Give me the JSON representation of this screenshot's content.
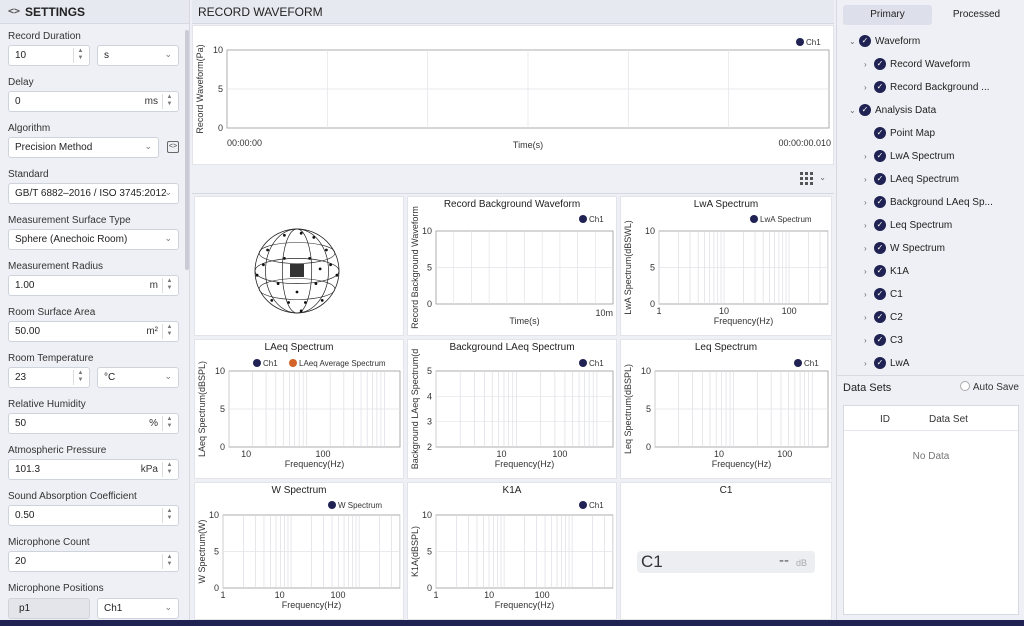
{
  "settings": {
    "title": "SETTINGS",
    "code_icon": "<>",
    "record_duration": {
      "label": "Record Duration",
      "value": "10",
      "unit": "s"
    },
    "delay": {
      "label": "Delay",
      "value": "0",
      "unit": "ms"
    },
    "algorithm": {
      "label": "Algorithm",
      "value": "Precision Method"
    },
    "standard": {
      "label": "Standard",
      "value": "GB/T 6882–2016 / ISO 3745:2012"
    },
    "surface_type": {
      "label": "Measurement Surface Type",
      "value": "Sphere (Anechoic Room)"
    },
    "radius": {
      "label": "Measurement Radius",
      "value": "1.00",
      "unit": "m"
    },
    "room_area": {
      "label": "Room Surface Area",
      "value": "50.00",
      "unit": "m²"
    },
    "room_temp": {
      "label": "Room Temperature",
      "value": "23",
      "unit": "°C"
    },
    "humidity": {
      "label": "Relative Humidity",
      "value": "50",
      "unit": "%"
    },
    "pressure": {
      "label": "Atmospheric Pressure",
      "value": "101.3",
      "unit": "kPa"
    },
    "absorption": {
      "label": "Sound Absorption Coefficient",
      "value": "0.50"
    },
    "mic_count": {
      "label": "Microphone Count",
      "value": "20"
    },
    "mic_positions": {
      "label": "Microphone Positions",
      "position": "p1",
      "channel": "Ch1"
    }
  },
  "record": {
    "title": "RECORD WAVEFORM",
    "legend": "Ch1",
    "ylabel": "Record Waveform(Pa)",
    "xlabel": "Time(s)",
    "yticks": [
      "10",
      "5",
      "0"
    ],
    "x_start": "00:00:00",
    "x_end": "00:00:00.010"
  },
  "panels": {
    "bg_waveform": {
      "title": "Record Background Waveform",
      "legend": "Ch1",
      "ylabel": "Record Background Waveform",
      "xlabel": "Time(s)",
      "yticks": [
        "10",
        "5",
        "0"
      ],
      "x_end": "10m"
    },
    "lwa": {
      "title": "LwA Spectrum",
      "legend": "LwA Spectrum",
      "ylabel": "LwA Spectrum(dBSWL)",
      "xlabel": "Frequency(Hz)",
      "yticks": [
        "10",
        "5",
        "0"
      ],
      "xticks": [
        "1",
        "10",
        "100"
      ]
    },
    "laeq": {
      "title": "LAeq Spectrum",
      "legend": "Ch1",
      "legend2": "LAeq Average Spectrum",
      "ylabel": "LAeq Spectrum(dBSPL)",
      "xlabel": "Frequency(Hz)",
      "yticks": [
        "10",
        "5",
        "0"
      ],
      "xticks": [
        "10",
        "100"
      ]
    },
    "bg_laeq": {
      "title": "Background LAeq Spectrum",
      "legend": "Ch1",
      "ylabel": "Background LAeq Spectrum(d",
      "xlabel": "Frequency(Hz)",
      "yticks": [
        "5",
        "4",
        "3",
        "2"
      ],
      "xticks": [
        "10",
        "100"
      ]
    },
    "leq": {
      "title": "Leq Spectrum",
      "legend": "Ch1",
      "ylabel": "Leq Spectrum(dBSPL)",
      "xlabel": "Frequency(Hz)",
      "yticks": [
        "10",
        "5",
        "0"
      ],
      "xticks": [
        "10",
        "100"
      ]
    },
    "w": {
      "title": "W Spectrum",
      "legend": "W Spectrum",
      "ylabel": "W Spectrum(W)",
      "xlabel": "Frequency(Hz)",
      "yticks": [
        "10",
        "5",
        "0"
      ],
      "xticks": [
        "1",
        "10",
        "100"
      ]
    },
    "k1a": {
      "title": "K1A",
      "legend": "Ch1",
      "ylabel": "K1A(dBSPL)",
      "xlabel": "Frequency(Hz)",
      "yticks": [
        "10",
        "5",
        "0"
      ],
      "xticks": [
        "1",
        "10",
        "100"
      ]
    },
    "c1": {
      "title": "C1",
      "label": "C1",
      "value": "--",
      "unit": "dB"
    }
  },
  "colors": {
    "ch1": "#1f2252",
    "laeq_avg": "#d2642a",
    "accent": "#1f2252"
  },
  "right": {
    "tabs": [
      "Primary",
      "Processed"
    ],
    "tree": [
      {
        "label": "Waveform",
        "level": 0,
        "expanded": true
      },
      {
        "label": "Record Waveform",
        "level": 1
      },
      {
        "label": "Record Background ...",
        "level": 1
      },
      {
        "label": "Analysis Data",
        "level": 0,
        "expanded": true
      },
      {
        "label": "Point Map",
        "level": 1,
        "leaf": true
      },
      {
        "label": "LwA Spectrum",
        "level": 1
      },
      {
        "label": "LAeq Spectrum",
        "level": 1
      },
      {
        "label": "Background LAeq Sp...",
        "level": 1
      },
      {
        "label": "Leq Spectrum",
        "level": 1
      },
      {
        "label": "W Spectrum",
        "level": 1
      },
      {
        "label": "K1A",
        "level": 1
      },
      {
        "label": "C1",
        "level": 1
      },
      {
        "label": "C2",
        "level": 1
      },
      {
        "label": "C3",
        "level": 1
      },
      {
        "label": "LwA",
        "level": 1
      }
    ],
    "datasets": {
      "title": "Data Sets",
      "auto_save": "Auto Save",
      "col_id": "ID",
      "col_set": "Data Set",
      "empty": "No Data"
    }
  }
}
